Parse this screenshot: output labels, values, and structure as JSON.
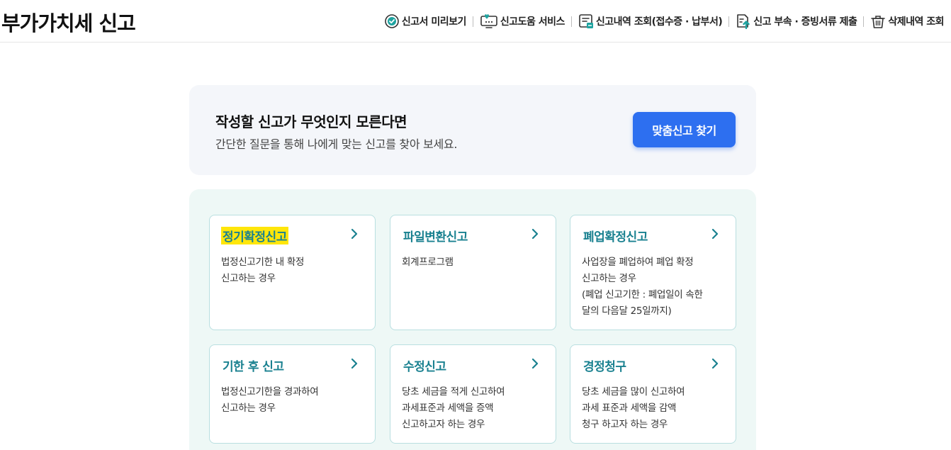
{
  "header": {
    "title": "부가가치세 신고",
    "menu": [
      {
        "label": "신고서 미리보기",
        "icon": "check-circle-icon"
      },
      {
        "label": "신고도움 서비스",
        "icon": "help-monitor-icon"
      },
      {
        "label": "신고내역 조회(접수증 · 납부서)",
        "icon": "document-list-icon"
      },
      {
        "label": "신고 부속 · 증빙서류 제출",
        "icon": "upload-document-icon"
      },
      {
        "label": "삭제내역 조회",
        "icon": "trash-icon"
      }
    ]
  },
  "banner": {
    "title": "작성할 신고가 무엇인지 모른다면",
    "subtitle": "간단한 질문을 통해 나에게 맞는 신고를 찾아 보세요.",
    "button_label": "맞춤신고 찾기"
  },
  "cards": [
    {
      "title": "정기확정신고",
      "desc": "법정신고기한 내 확정\n신고하는 경우",
      "highlighted": true
    },
    {
      "title": "파일변환신고",
      "desc": "회계프로그램"
    },
    {
      "title": "폐업확정신고",
      "desc": "사업장을 폐업하여 폐업 확정\n신고하는 경우\n(폐업 신고기한 : 폐업일이 속한\n달의 다음달 25일까지)"
    },
    {
      "title": "기한 후 신고",
      "desc": "법정신고기한을 경과하여\n신고하는 경우"
    },
    {
      "title": "수정신고",
      "desc": "당초 세금을 적게 신고하여\n과세표준과 세액을 증액\n신고하고자 하는 경우"
    },
    {
      "title": "경정청구",
      "desc": "당초 세금을 많이 신고하여\n과세 표준과 세액을 감액\n청구 하고자 하는 경우"
    }
  ],
  "colors": {
    "accent": "#2d6ff0",
    "card_title": "#1a8190",
    "highlight": "#ffe60a",
    "card_area_bg": "#eef8f6",
    "banner_bg": "#f4f6fa"
  }
}
